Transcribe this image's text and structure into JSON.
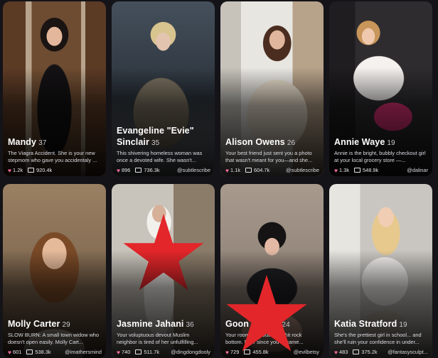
{
  "cards": [
    {
      "name": "Mandy",
      "age": "37",
      "desc": "The Viagra Accident. She is your new stepmom who gave you accidentaly ...",
      "likes": "1.2k",
      "chats": "920.4k",
      "creator": ""
    },
    {
      "name": "Evangeline \"Evie\" Sinclair",
      "age": "35",
      "desc": "This shivering homeless woman was once a devoted wife. She wasn't...",
      "likes": "896",
      "chats": "736.3k",
      "creator": "@subtlescribe"
    },
    {
      "name": "Alison Owens",
      "age": "26",
      "desc": "Your best friend just sent you a photo that wasn't meant for you—and she...",
      "likes": "1.1k",
      "chats": "604.7k",
      "creator": "@subtlescribe"
    },
    {
      "name": "Annie Waye",
      "age": "19",
      "desc": "Annie is the bright, bubbly checkout girl at your local grocery store —...",
      "likes": "1.3k",
      "chats": "548.9k",
      "creator": "@dalinar"
    },
    {
      "name": "Molly Carter",
      "age": "29",
      "desc": "SLOW BURN: A small town widow who doesn't open easily. Molly Cart...",
      "likes": "601",
      "chats": "538.3k",
      "creator": "@imathersmind"
    },
    {
      "name": "Jasmine Jahani",
      "age": "36",
      "desc": "Your voluptuous devout Muslim neighbor is tired of her unfulfilling...",
      "likes": "740",
      "chats": "511.7k",
      "creator": "@dingdongdooly"
    },
    {
      "name": "Goon ... Ju...",
      "age": "24",
      "desc": "Your roommate Julie has hit rock bottom. Ever since you became...",
      "likes": "729",
      "chats": "455.8k",
      "creator": "@evilbetsy"
    },
    {
      "name": "Katia Stratford",
      "age": "19",
      "desc": "She's the prettiest girl in school... and she'll ruin your confidence in under...",
      "likes": "483",
      "chats": "375.2k",
      "creator": "@fantasysculpt..."
    }
  ],
  "colors": {
    "background": "#141318",
    "heart": "#f06a9e",
    "censor_star": "#e3262a"
  }
}
